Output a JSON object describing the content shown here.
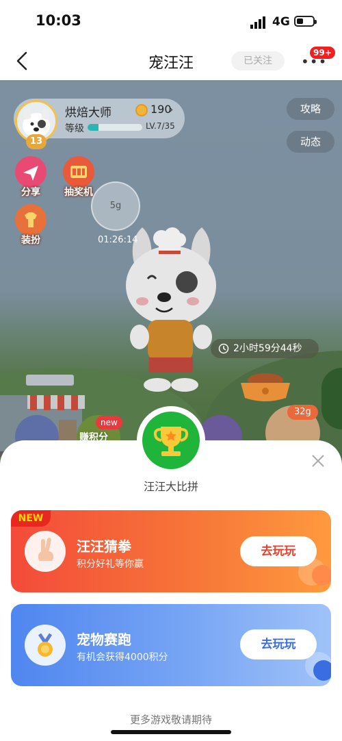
{
  "status": {
    "time": "10:03",
    "network": "4G"
  },
  "nav": {
    "title": "宠汪汪",
    "follow_label": "已关注",
    "more_icon": "ellipsis-icon",
    "badge": "99+"
  },
  "profile": {
    "name": "烘焙大师",
    "coins": "190",
    "level_label": "等级",
    "level_text": "LV.7/35",
    "level_progress": 0.2,
    "badge_level": "13"
  },
  "scene_buttons": {
    "strategy": "攻略",
    "activity": "动态",
    "share": "分享",
    "lottery": "抽奖机",
    "dress": "装扮",
    "earn_points": "赚积分",
    "new_tag": "new"
  },
  "bubble": {
    "amount": "5g",
    "timer": "01:26:14"
  },
  "countdown": "2小时59分44秒",
  "food_tag": "32g",
  "sheet": {
    "title": "汪汪大比拼",
    "games": [
      {
        "tag": "NEW",
        "title": "汪汪猜拳",
        "subtitle": "积分好礼等你赢",
        "button": "去玩玩",
        "icon": "victory-hand-icon"
      },
      {
        "title": "宠物赛跑",
        "subtitle": "有机会获得4000积分",
        "button": "去玩玩",
        "icon": "medal-icon"
      }
    ],
    "footer": "更多游戏敬请期待"
  },
  "colors": {
    "accent_red": "#f34b3a",
    "accent_blue": "#4f86f0",
    "trophy_green": "#1fb43a"
  }
}
